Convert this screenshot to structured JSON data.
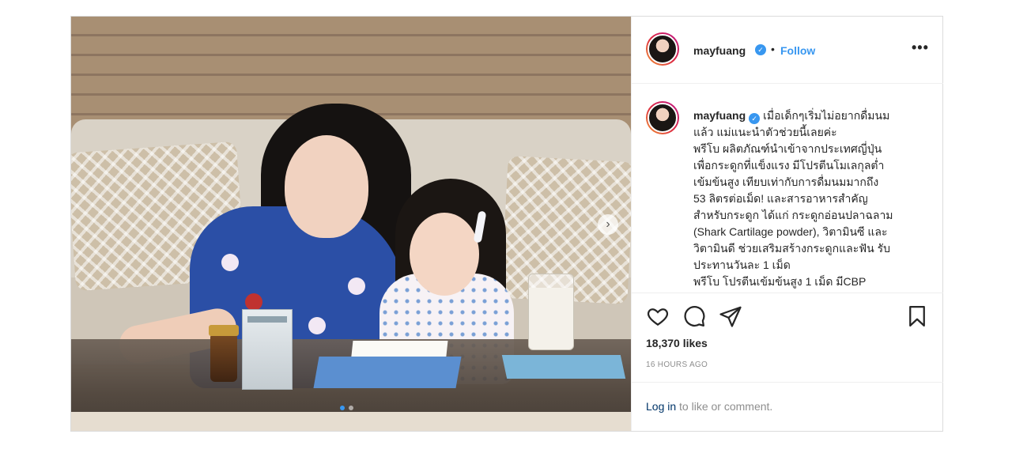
{
  "post": {
    "username": "mayfuang",
    "verified_badge": "✓",
    "separator": "•",
    "follow_label": "Follow",
    "more_label": "•••",
    "caption_lines": [
      "เมื่อเด็กๆเริ่มไม่อยากดื่มนม",
      "แล้ว   แม่แนะนำตัวช่วยนี้เลยค่ะ",
      "พรีโบ ผลิตภัณฑ์นำเข้าจากประเทศญี่ปุ่น",
      "เพื่อกระดูกที่แข็งแรง มีโปรตีนโมเลกุลต่ำ",
      "เข้มข้นสูง เทียบเท่ากับการดื่มนมมากถึง",
      "53 ลิตรต่อเม็ด!  และสารอาหารสำคัญ",
      "สำหรับกระดูก ได้แก่ กระดูกอ่อนปลาฉลาม",
      "(Shark Cartilage powder), วิตามินซี และ",
      "วิตามินดี ช่วยเสริมสร้างกระดูกและฟัน รับ",
      "ประทานวันละ 1 เม็ด",
      "พรีโบ โปรตีนเข้มข้นสูง 1 เม็ด มีCBP"
    ],
    "likes": "18,370 likes",
    "time": "16 HOURS AGO",
    "login_link": "Log in",
    "login_rest": " to like or comment."
  },
  "icons": {
    "like": "heart-icon",
    "comment": "comment-icon",
    "share": "share-icon",
    "save": "bookmark-icon",
    "next": "chevron-right-icon"
  },
  "colors": {
    "accent": "#3897f0",
    "text": "#262626",
    "muted": "#8e8e8e",
    "link": "#003569",
    "border": "#dbdbdb"
  },
  "carousel": {
    "dots": 2,
    "active_index": 0
  }
}
